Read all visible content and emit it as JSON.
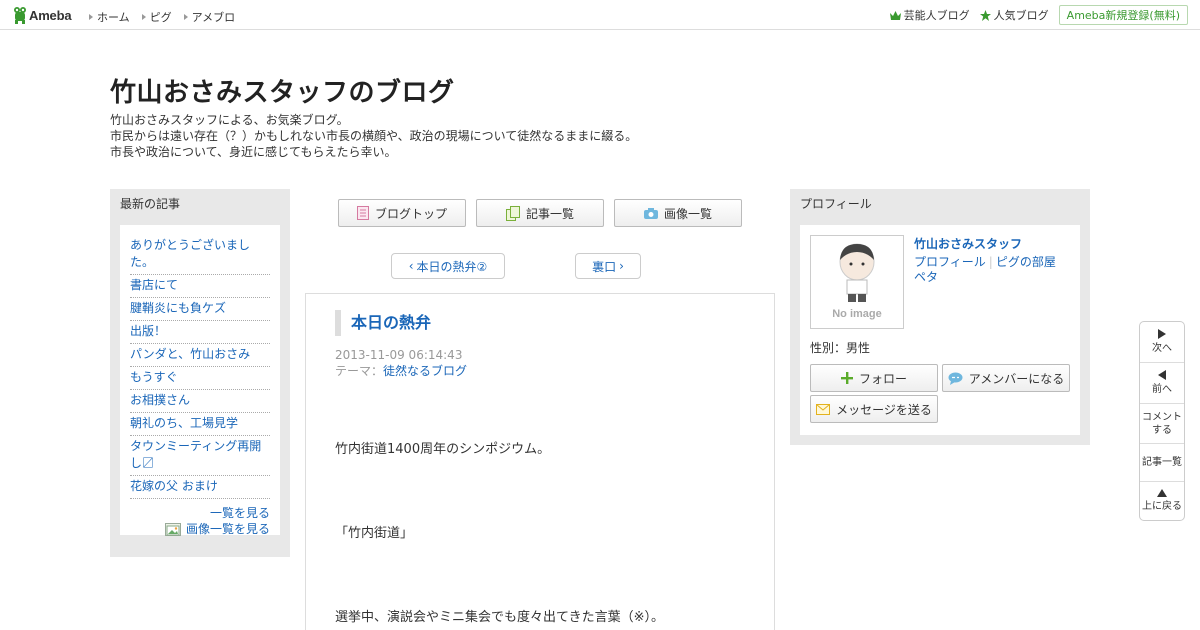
{
  "topbar": {
    "logo_text": "Ameba",
    "nav": [
      "ホーム",
      "ピグ",
      "アメブロ"
    ],
    "celebrity_blog": "芸能人ブログ",
    "popular_blog": "人気ブログ",
    "register": "Ameba新規登録(無料)"
  },
  "header": {
    "title": "竹山おさみスタッフのブログ",
    "desc": [
      "竹山おさみスタッフによる、お気楽ブログ。",
      "市民からは遠い存在（？）かもしれない市長の横顔や、政治の現場について徒然なるままに綴る。",
      "市長や政治について、身近に感じてもらえたら幸い。"
    ]
  },
  "sidebar_left": {
    "heading": "最新の記事",
    "entries": [
      "ありがとうございました。",
      "書店にて",
      "腱鞘炎にも負ケズ",
      "出版！",
      "パンダと、竹山おさみ",
      "もうすぐ",
      "お相撲さん",
      "朝礼のち、工場見学",
      "タウンミーティング再開し〼",
      "花嫁の父 おまけ"
    ],
    "more_list": "一覧を見る",
    "more_images": "画像一覧を見る"
  },
  "center": {
    "buttons": [
      "ブログトップ",
      "記事一覧",
      "画像一覧"
    ],
    "prev": "本日の熱弁②",
    "next": "裏口",
    "article": {
      "title": "本日の熱弁",
      "datetime": "2013-11-09 06:14:43",
      "theme_label": "テーマ：",
      "theme": "徒然なるブログ",
      "body": [
        "竹内街道1400周年のシンポジウム。",
        "「竹内街道」",
        "選挙中、演説会やミニ集会でも度々出てきた言葉（※）。"
      ]
    }
  },
  "sidebar_right": {
    "heading": "プロフィール",
    "no_image": "No image",
    "name": "竹山おさみスタッフ",
    "links": [
      "プロフィール",
      "ピグの部屋",
      "ペタ"
    ],
    "gender": "性別：男性",
    "follow": "フォロー",
    "amember": "アメンバーになる",
    "message": "メッセージを送る"
  },
  "floatnav": {
    "next": "次へ",
    "prev": "前へ",
    "comment": [
      "コメント",
      "する"
    ],
    "list": "記事一覧",
    "top": "上に戻る"
  },
  "colors": {
    "link": "#1a66b8",
    "sidebar_bg": "#e8e8e8",
    "register_green": "#3a9a30"
  }
}
